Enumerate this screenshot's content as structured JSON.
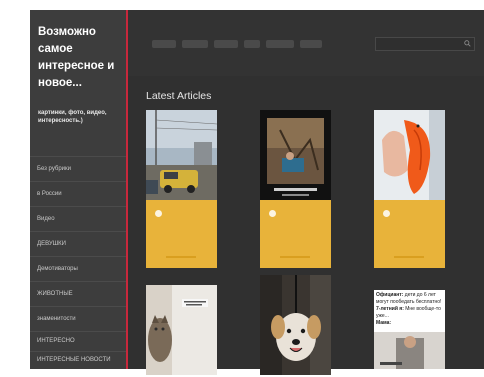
{
  "site": {
    "title": "Возможно самое интересное и новое...",
    "tagline": "картинки, фото, видео, интересность.)"
  },
  "sidebar": {
    "categories": [
      {
        "label": "Без рубрики"
      },
      {
        "label": "в России"
      },
      {
        "label": "Видео"
      },
      {
        "label": "ДЕВУШКИ"
      },
      {
        "label": "Демотиваторы"
      },
      {
        "label": "ЖИВОТНЫЕ"
      },
      {
        "label": "знаменитости"
      },
      {
        "label": "ИНТЕРЕСНО"
      },
      {
        "label": "ИНТЕРЕСНЫЕ НОВОСТИ"
      }
    ]
  },
  "header": {
    "nav_items": [
      "",
      "",
      "",
      "",
      "",
      ""
    ],
    "search_placeholder": ""
  },
  "main": {
    "section_title": "Latest Articles",
    "articles_row1": [
      {
        "caption": "",
        "meta": ""
      },
      {
        "caption": "",
        "meta": ""
      },
      {
        "caption": "",
        "meta": ""
      }
    ],
    "articles_row2": [
      {
        "caption": ""
      },
      {
        "caption": ""
      },
      {
        "caption": "Официант: дети до 6 лет могут пообедать бесплатно! 7-летний я: Мне вообще-то уже... Мама:"
      }
    ],
    "meme": {
      "line1_bold": "Официант:",
      "line1": " дети до 6 лет могут пообедать бесплатно!",
      "line2_bold": "7-летний я:",
      "line2": " Мне вообще-то уже...",
      "line3_bold": "Мама:"
    }
  },
  "colors": {
    "sidebar_bg": "#3d3d3d",
    "main_bg": "#303030",
    "accent_red": "#c8283c",
    "caption_yellow": "#e8b33a"
  }
}
